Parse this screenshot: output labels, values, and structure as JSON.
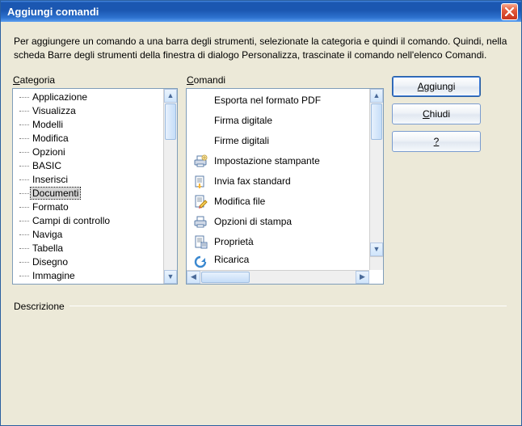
{
  "title": "Aggiungi comandi",
  "instructions": "Per aggiungere un comando a una barra degli strumenti, selezionate la categoria e quindi il comando. Quindi, nella scheda Barre degli strumenti della finestra di dialogo Personalizza, trascinate il comando nell'elenco Comandi.",
  "labels": {
    "categoria_prefix": "C",
    "categoria_rest": "ategoria",
    "comandi_prefix": "C",
    "comandi_rest": "omandi",
    "descrizione": "Descrizione"
  },
  "buttons": {
    "aggiungi_prefix": "A",
    "aggiungi_rest": "ggiungi",
    "chiudi_prefix": "C",
    "chiudi_rest": "hiudi",
    "help": "?"
  },
  "categories": [
    "Applicazione",
    "Visualizza",
    "Modelli",
    "Modifica",
    "Opzioni",
    "BASIC",
    "Inserisci",
    "Documenti",
    "Formato",
    "Campi di controllo",
    "Naviga",
    "Tabella",
    "Disegno",
    "Immagine"
  ],
  "selected_category_index": 7,
  "commands": [
    {
      "label": "Esporta nel formato PDF",
      "icon": "none"
    },
    {
      "label": "Firma digitale",
      "icon": "none"
    },
    {
      "label": "Firme digitali",
      "icon": "none"
    },
    {
      "label": "Impostazione stampante",
      "icon": "printer-settings"
    },
    {
      "label": "Invia fax standard",
      "icon": "fax-send"
    },
    {
      "label": "Modifica file",
      "icon": "edit-file"
    },
    {
      "label": "Opzioni di stampa",
      "icon": "print-options"
    },
    {
      "label": "Proprietà",
      "icon": "properties"
    },
    {
      "label": "Ricarica",
      "icon": "reload"
    }
  ]
}
